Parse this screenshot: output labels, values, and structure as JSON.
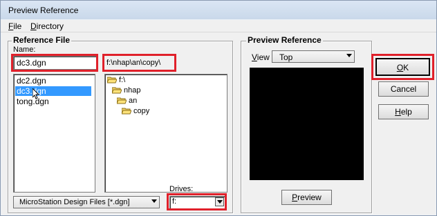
{
  "window": {
    "title": "Preview Reference"
  },
  "menu": [
    {
      "underline": "F",
      "rest": "ile"
    },
    {
      "underline": "D",
      "rest": "irectory"
    }
  ],
  "reference_file": {
    "legend": "Reference File",
    "name_label": "Name:",
    "name_value": "dc3.dgn",
    "files": [
      "dc2.dgn",
      "dc3.dgn",
      "tong.dgn"
    ],
    "selected_index": 1,
    "current_path": "f:\\nhap\\an\\copy\\",
    "directories": [
      "f:\\",
      "nhap",
      "an",
      "copy"
    ],
    "file_type": "MicroStation Design Files [*.dgn]",
    "drives_label": "Drives:",
    "drive": "f:"
  },
  "preview": {
    "legend": "Preview Reference",
    "view_label": "View",
    "view_value": "Top",
    "button": "Preview",
    "button_underline_index": 0
  },
  "buttons": {
    "ok": "OK",
    "cancel": "Cancel",
    "help": "Help"
  },
  "colors": {
    "highlight": "#e0202a",
    "selection": "#3399ff"
  }
}
